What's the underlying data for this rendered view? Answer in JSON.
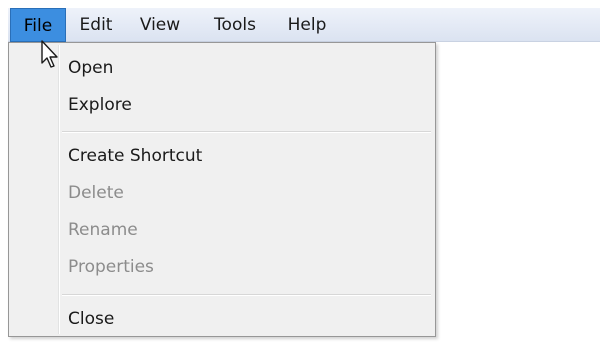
{
  "menubar": {
    "items": [
      {
        "label": "File",
        "active": true
      },
      {
        "label": "Edit",
        "active": false
      },
      {
        "label": "View",
        "active": false
      },
      {
        "label": "Tools",
        "active": false
      },
      {
        "label": "Help",
        "active": false
      }
    ]
  },
  "file_menu": {
    "items": [
      {
        "label": "Open",
        "enabled": true
      },
      {
        "label": "Explore",
        "enabled": true
      },
      {
        "label": "Create Shortcut",
        "enabled": true
      },
      {
        "label": "Delete",
        "enabled": false
      },
      {
        "label": "Rename",
        "enabled": false
      },
      {
        "label": "Properties",
        "enabled": false
      },
      {
        "label": "Close",
        "enabled": true
      }
    ]
  },
  "colors": {
    "active_menu_bg": "#3c8ee0",
    "menu_bg": "#f0f0f0",
    "disabled_text": "#8c8c8c"
  },
  "cursor": {
    "icon": "arrow-pointer-icon"
  }
}
